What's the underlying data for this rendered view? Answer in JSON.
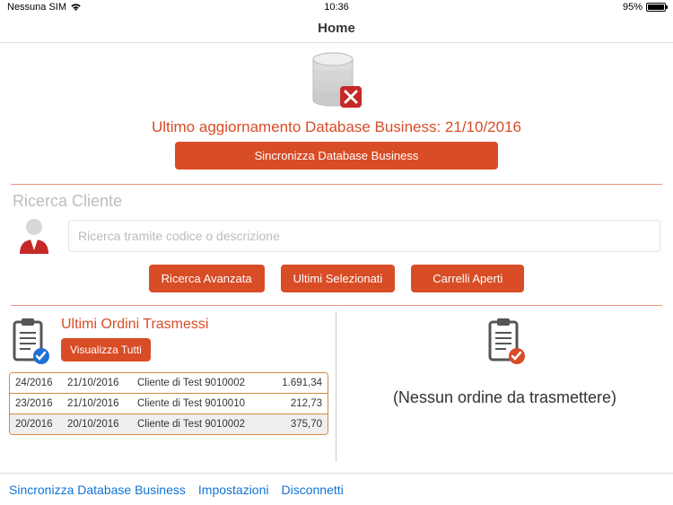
{
  "status": {
    "carrier": "Nessuna SIM",
    "time": "10:36",
    "battery_pct": "95%"
  },
  "nav": {
    "title": "Home"
  },
  "top": {
    "last_update_label": "Ultimo aggiornamento Database Business: 21/10/2016",
    "sync_button": "Sincronizza Database Business"
  },
  "search": {
    "section_label": "Ricerca Cliente",
    "placeholder": "Ricerca tramite codice o descrizione",
    "btn_advanced": "Ricerca Avanzata",
    "btn_last_selected": "Ultimi Selezionati",
    "btn_open_carts": "Carrelli Aperti"
  },
  "orders_left": {
    "title": "Ultimi Ordini Trasmessi",
    "view_all": "Visualizza Tutti",
    "rows": [
      {
        "c1": "24/2016",
        "c2": "21/10/2016",
        "c3": "Cliente di Test 9010002",
        "c4": "1.691,34"
      },
      {
        "c1": "23/2016",
        "c2": "21/10/2016",
        "c3": "Cliente di Test 9010010",
        "c4": "212,73"
      },
      {
        "c1": "20/2016",
        "c2": "20/10/2016",
        "c3": "Cliente di Test 9010002",
        "c4": "375,70"
      }
    ]
  },
  "orders_right": {
    "empty_label": "(Nessun ordine da trasmettere)"
  },
  "bottom": {
    "sync": "Sincronizza Database Business",
    "settings": "Impostazioni",
    "logout": "Disconnetti"
  }
}
